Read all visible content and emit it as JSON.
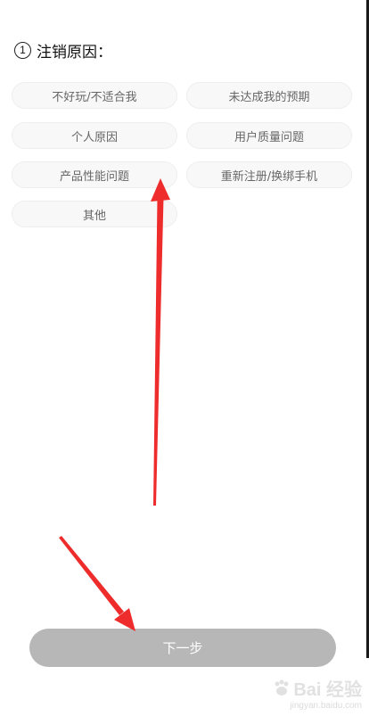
{
  "section": {
    "step_number": "1",
    "title": "注销原因："
  },
  "reasons": [
    {
      "label": "不好玩/不适合我"
    },
    {
      "label": "未达成我的预期"
    },
    {
      "label": "个人原因"
    },
    {
      "label": "用户质量问题"
    },
    {
      "label": "产品性能问题"
    },
    {
      "label": "重新注册/换绑手机"
    },
    {
      "label": "其他"
    }
  ],
  "footer": {
    "next_label": "下一步"
  },
  "watermark": {
    "brand": "Bai 经验",
    "url": "jingyan.baidu.com"
  },
  "colors": {
    "annotation_arrow": "#ee2c2c",
    "button_disabled": "#b7b7b7",
    "chip_bg": "#f8f8f8"
  }
}
